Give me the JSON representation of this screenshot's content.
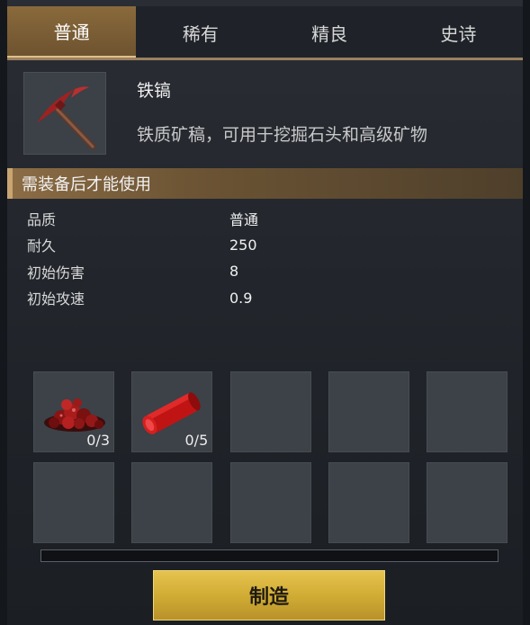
{
  "tabs": [
    {
      "label": "普通",
      "active": true
    },
    {
      "label": "稀有",
      "active": false
    },
    {
      "label": "精良",
      "active": false
    },
    {
      "label": "史诗",
      "active": false
    }
  ],
  "item": {
    "icon": "pickaxe-icon",
    "name": "铁镐",
    "description": "铁质矿稿，可用于挖掘石头和高级矿物"
  },
  "requirement": "需装备后才能使用",
  "stats": [
    {
      "label": "品质",
      "value": "普通"
    },
    {
      "label": "耐久",
      "value": "250"
    },
    {
      "label": "初始伤害",
      "value": "8"
    },
    {
      "label": "初始攻速",
      "value": "0.9"
    }
  ],
  "materials": [
    {
      "icon": "red-ore-pile-icon",
      "count": "0/3"
    },
    {
      "icon": "red-log-icon",
      "count": "0/5"
    }
  ],
  "progress": 0,
  "craft_button": "制造",
  "colors": {
    "tab_active": "#8a6a3c",
    "requirement_bar": "#8b6c45",
    "button": "#d9b540"
  }
}
